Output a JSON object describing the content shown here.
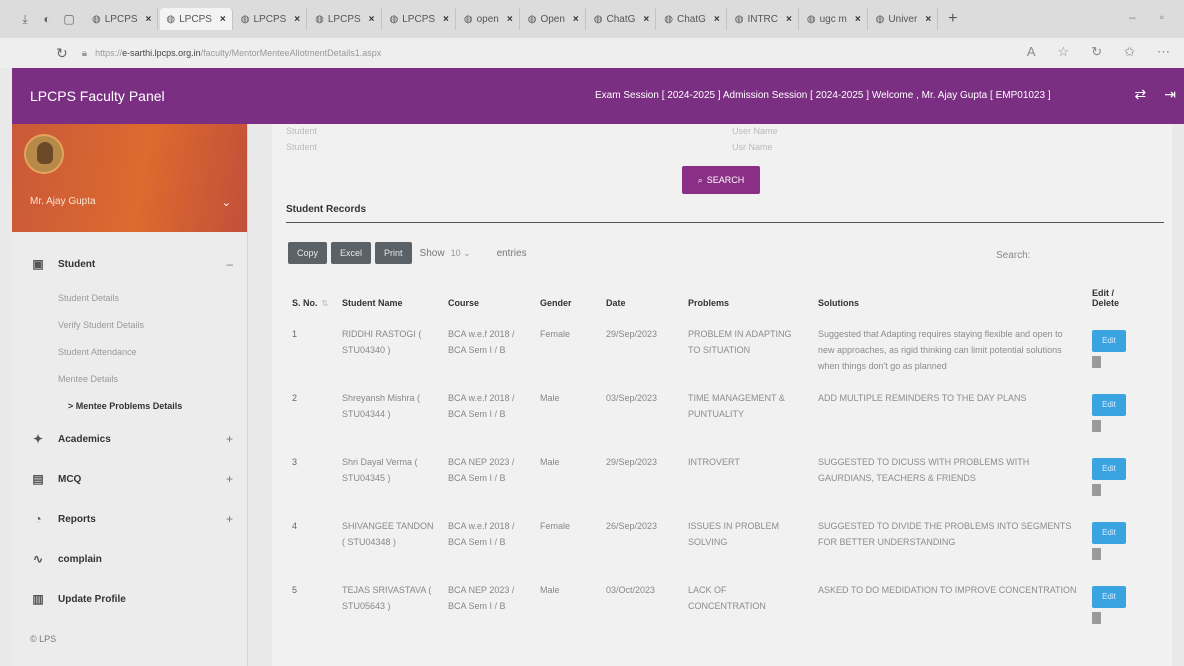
{
  "browser": {
    "tabs": [
      {
        "label": "LPCPS"
      },
      {
        "label": "LPCPS"
      },
      {
        "label": "LPCPS"
      },
      {
        "label": "LPCPS"
      },
      {
        "label": "LPCPS"
      },
      {
        "label": "open"
      },
      {
        "label": "Open"
      },
      {
        "label": "ChatG"
      },
      {
        "label": "ChatG"
      },
      {
        "label": "INTRC"
      },
      {
        "label": "ugc m"
      },
      {
        "label": "Univer"
      }
    ],
    "url_prefix": "https://",
    "url_domain": "e-sarthi.lpcps.org.in",
    "url_path": "/faculty/MentorMenteeAllotmentDetails1.aspx"
  },
  "header": {
    "brand": "LPCPS Faculty Panel",
    "session": "Exam Session [ 2024-2025 ]   Admission Session [ 2024-2025 ]   Welcome , Mr. Ajay Gupta [ EMP01023 ]"
  },
  "sidebar": {
    "user_name": "Mr. Ajay Gupta",
    "student_label": "Student",
    "student_items": [
      {
        "label": "Student Details"
      },
      {
        "label": "Verify Student Details"
      },
      {
        "label": "Student Attendance"
      },
      {
        "label": "Mentee Details"
      },
      {
        "label": "> Mentee Problems Details"
      }
    ],
    "academics_label": "Academics",
    "mcq_label": "MCQ",
    "reports_label": "Reports",
    "complain_label": "complain",
    "update_profile_label": "Update Profile",
    "footer": "© LPS"
  },
  "content": {
    "student_label": "Student",
    "student_placeholder": "Student",
    "username_label": "User Name",
    "username_placeholder": "Usr Name",
    "search_button": "SEARCH",
    "records_title": "Student Records",
    "copy": "Copy",
    "excel": "Excel",
    "print": "Print",
    "show": "Show",
    "entries_value": "10",
    "entries": "entries",
    "search_label": "Search:",
    "columns": {
      "sno": "S. No.",
      "name": "Student Name",
      "course": "Course",
      "gender": "Gender",
      "date": "Date",
      "problems": "Problems",
      "solutions": "Solutions",
      "edit": "Edit / Delete"
    },
    "edit_label": "Edit",
    "rows": [
      {
        "sno": "1",
        "name": "RIDDHI RASTOGI ( STU04340 )",
        "course": "BCA w.e.f 2018 / BCA Sem I / B",
        "gender": "Female",
        "date": "29/Sep/2023",
        "problems": "PROBLEM IN ADAPTING TO SITUATION",
        "solutions": "Suggested that Adapting requires staying flexible and open to new approaches, as rigid thinking can limit potential solutions when things don't go as planned"
      },
      {
        "sno": "2",
        "name": "Shreyansh Mishra ( STU04344 )",
        "course": "BCA w.e.f 2018 / BCA Sem I / B",
        "gender": "Male",
        "date": "03/Sep/2023",
        "problems": "TIME MANAGEMENT & PUNTUALITY",
        "solutions": "ADD MULTIPLE REMINDERS TO THE DAY PLANS"
      },
      {
        "sno": "3",
        "name": "Shri Dayal Verma ( STU04345 )",
        "course": "BCA NEP 2023 / BCA Sem I / B",
        "gender": "Male",
        "date": "29/Sep/2023",
        "problems": "INTROVERT",
        "solutions": "SUGGESTED TO DICUSS WITH PROBLEMS WITH GAURDIANS, TEACHERS & FRIENDS"
      },
      {
        "sno": "4",
        "name": "SHIVANGEE TANDON ( STU04348 )",
        "course": "BCA w.e.f 2018 / BCA Sem I / B",
        "gender": "Female",
        "date": "26/Sep/2023",
        "problems": "ISSUES IN PROBLEM SOLVING",
        "solutions": "SUGGESTED TO DIVIDE THE PROBLEMS INTO SEGMENTS FOR BETTER UNDERSTANDING"
      },
      {
        "sno": "5",
        "name": "TEJAS SRIVASTAVA ( STU05643 )",
        "course": "BCA NEP 2023 / BCA Sem I / B",
        "gender": "Male",
        "date": "03/Oct/2023",
        "problems": "LACK OF CONCENTRATION",
        "solutions": "ASKED TO DO MEDIDATION TO IMPROVE CONCENTRATION"
      }
    ]
  },
  "colors": {
    "header": "#7b2f82",
    "profile": "#dd6a2e",
    "search_button": "#8a2f85",
    "export_button": "#5a6268",
    "edit_button": "#3aa4e0"
  }
}
